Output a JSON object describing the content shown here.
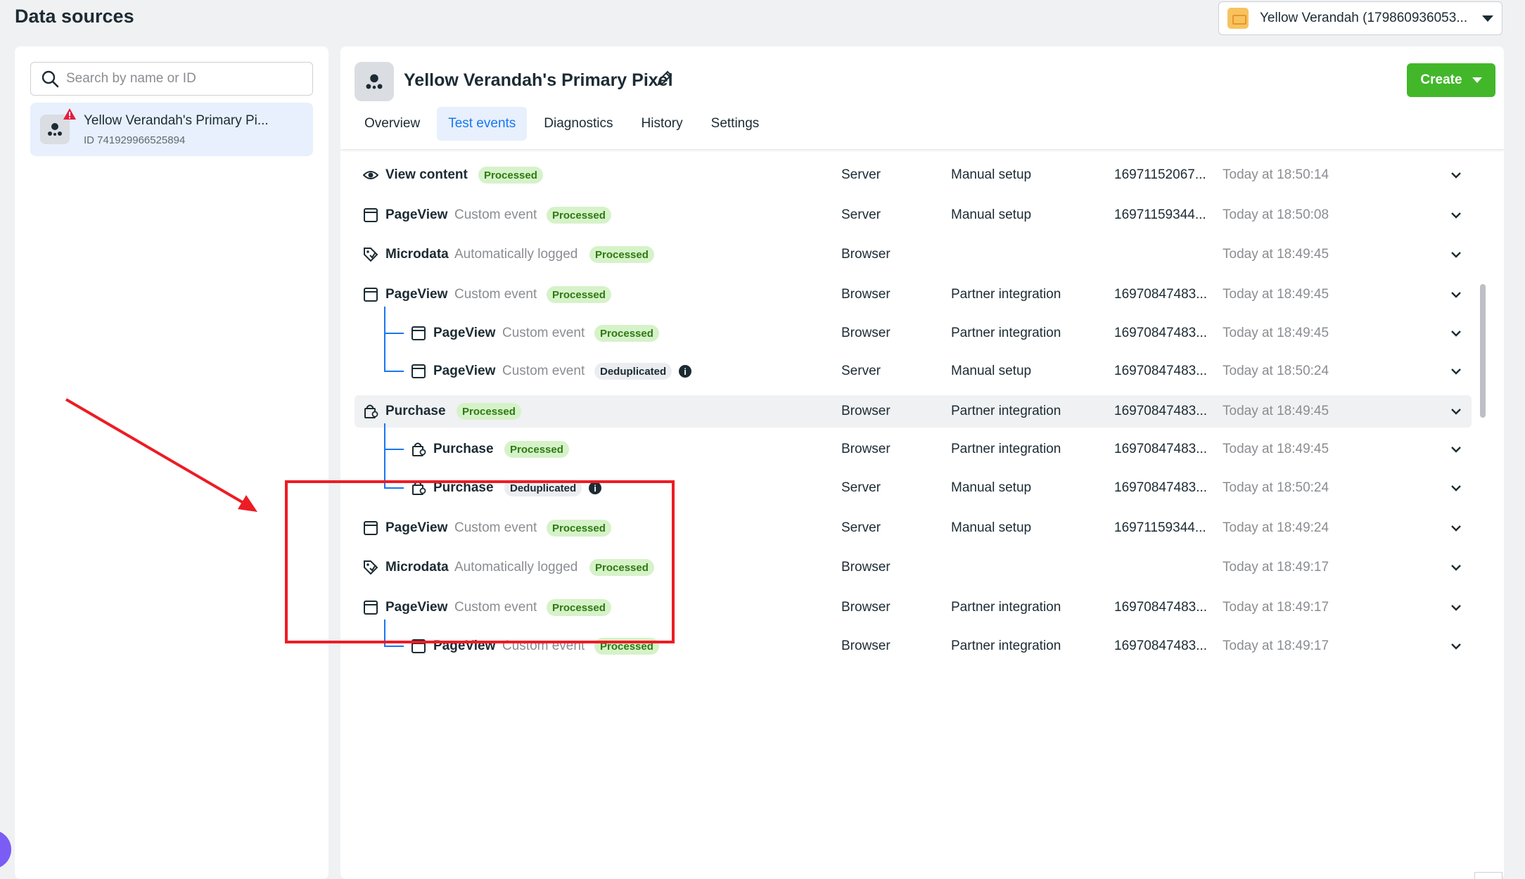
{
  "page": {
    "title": "Data sources"
  },
  "account": {
    "label": "Yellow Verandah (179860936053..."
  },
  "search": {
    "placeholder": "Search by name or ID"
  },
  "source_list": [
    {
      "name": "Yellow Verandah's Primary Pi...",
      "id_text": "ID 741929966525894"
    }
  ],
  "pixel": {
    "title": "Yellow Verandah's Primary Pixel",
    "create_label": "Create"
  },
  "tabs": [
    {
      "label": "Overview",
      "active": false
    },
    {
      "label": "Test events",
      "active": true
    },
    {
      "label": "Diagnostics",
      "active": false
    },
    {
      "label": "History",
      "active": false
    },
    {
      "label": "Settings",
      "active": false
    }
  ],
  "events": [
    {
      "icon": "eye-icon",
      "name": "View content",
      "sub": "",
      "status": "Processed",
      "source": "Server",
      "setup": "Manual setup",
      "event_id": "16971152067...",
      "time": "Today at 18:50:14",
      "level": 0
    },
    {
      "icon": "browser-window-icon",
      "name": "PageView",
      "sub": "Custom event",
      "status": "Processed",
      "source": "Server",
      "setup": "Manual setup",
      "event_id": "16971159344...",
      "time": "Today at 18:50:08",
      "level": 0
    },
    {
      "icon": "tag-icon",
      "name": "Microdata",
      "sub": "Automatically logged",
      "status": "Processed",
      "source": "Browser",
      "setup": "",
      "event_id": "",
      "time": "Today at 18:49:45",
      "level": 0
    },
    {
      "icon": "browser-window-icon",
      "name": "PageView",
      "sub": "Custom event",
      "status": "Processed",
      "source": "Browser",
      "setup": "Partner integration",
      "event_id": "16970847483...",
      "time": "Today at 18:49:45",
      "level": 0
    },
    {
      "icon": "browser-window-icon",
      "name": "PageView",
      "sub": "Custom event",
      "status": "Processed",
      "source": "Browser",
      "setup": "Partner integration",
      "event_id": "16970847483...",
      "time": "Today at 18:49:45",
      "level": 1
    },
    {
      "icon": "browser-window-icon",
      "name": "PageView",
      "sub": "Custom event",
      "status": "Deduplicated",
      "source": "Server",
      "setup": "Manual setup",
      "event_id": "16970847483...",
      "time": "Today at 18:50:24",
      "level": 1
    },
    {
      "icon": "shopping-bag-icon",
      "name": "Purchase",
      "sub": "",
      "status": "Processed",
      "source": "Browser",
      "setup": "Partner integration",
      "event_id": "16970847483...",
      "time": "Today at 18:49:45",
      "level": 0
    },
    {
      "icon": "shopping-bag-icon",
      "name": "Purchase",
      "sub": "",
      "status": "Processed",
      "source": "Browser",
      "setup": "Partner integration",
      "event_id": "16970847483...",
      "time": "Today at 18:49:45",
      "level": 1
    },
    {
      "icon": "shopping-bag-icon",
      "name": "Purchase",
      "sub": "",
      "status": "Deduplicated",
      "source": "Server",
      "setup": "Manual setup",
      "event_id": "16970847483...",
      "time": "Today at 18:50:24",
      "level": 1
    },
    {
      "icon": "browser-window-icon",
      "name": "PageView",
      "sub": "Custom event",
      "status": "Processed",
      "source": "Server",
      "setup": "Manual setup",
      "event_id": "16971159344...",
      "time": "Today at 18:49:24",
      "level": 0
    },
    {
      "icon": "tag-icon",
      "name": "Microdata",
      "sub": "Automatically logged",
      "status": "Processed",
      "source": "Browser",
      "setup": "",
      "event_id": "",
      "time": "Today at 18:49:17",
      "level": 0
    },
    {
      "icon": "browser-window-icon",
      "name": "PageView",
      "sub": "Custom event",
      "status": "Processed",
      "source": "Browser",
      "setup": "Partner integration",
      "event_id": "16970847483...",
      "time": "Today at 18:49:17",
      "level": 0
    },
    {
      "icon": "browser-window-icon",
      "name": "PageView",
      "sub": "Custom event",
      "status": "Processed",
      "source": "Browser",
      "setup": "Partner integration",
      "event_id": "16970847483...",
      "time": "Today at 18:49:17",
      "level": 1
    }
  ],
  "colors": {
    "accent": "#1877f2",
    "create": "#42b72a",
    "processed_bg": "#d6f2c9",
    "annotation": "#ec1c24"
  }
}
